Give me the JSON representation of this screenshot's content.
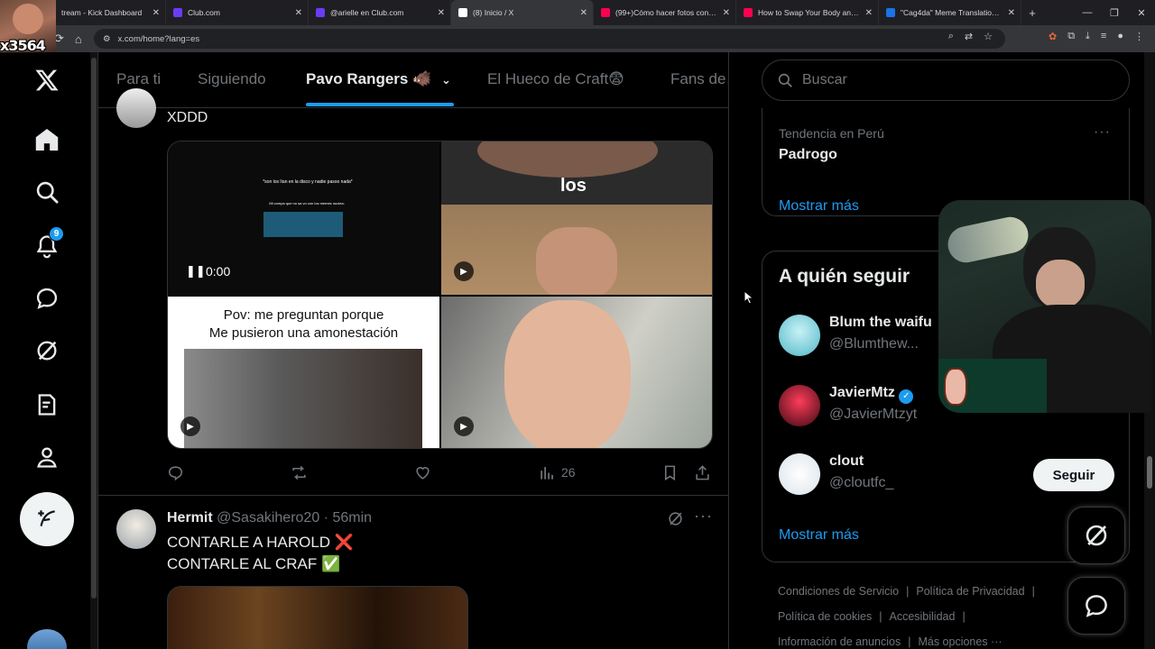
{
  "browser": {
    "tabs": [
      {
        "title": "tream - Kick Dashboard",
        "favicon_color": "#53fc18",
        "active": false
      },
      {
        "title": "Club.com",
        "favicon_color": "#6b3cf5",
        "active": false
      },
      {
        "title": "@arielle en Club.com",
        "favicon_color": "#6b3cf5",
        "active": false
      },
      {
        "title": "(8) Inicio / X",
        "favicon_color": "#ffffff",
        "active": true
      },
      {
        "title": "(99+)Cómo hacer fotos con tu",
        "favicon_color": "#ff0050",
        "active": false
      },
      {
        "title": "How to Swap Your Body and Fa",
        "favicon_color": "#ff0050",
        "active": false
      },
      {
        "title": "\"Cag4da\" Meme Translation To",
        "favicon_color": "#1a73e8",
        "active": false
      }
    ],
    "url": "x.com/home?lang=es"
  },
  "streamer_overlay": {
    "tag": "x3564"
  },
  "nav": {
    "notifications_count": "9"
  },
  "feed_tabs": {
    "items": [
      "Para ti",
      "Siguiendo",
      "Pavo Rangers 🐗",
      "El Hueco de Craft😨",
      "Fans de"
    ]
  },
  "post1": {
    "text": "XDDD",
    "media": {
      "video_time": "0:00",
      "cell1_caption": "*son los lían en la disco y nadie pasoo nada*",
      "cell1_sub": "Mi compa que no sa vo con los memes nuclea:",
      "cell2_caption": "los",
      "cell3_caption_line1": "Pov: me preguntan porque",
      "cell3_caption_line2": "Me pusieron una amonestación"
    },
    "views": "26"
  },
  "post2": {
    "name": "Hermit",
    "handle": "@Sasakihero20",
    "time": "· 56min",
    "line1": "CONTARLE A HAROLD ❌",
    "line2": "CONTARLE AL CRAF ✅"
  },
  "right": {
    "search_placeholder": "Buscar",
    "trend": {
      "context": "Tendencia en Perú",
      "name": "Padrogo"
    },
    "show_more_1": "Mostrar más",
    "who_to_follow": {
      "title": "A quién seguir",
      "accounts": [
        {
          "name": "Blum the waifu",
          "handle": "@Blumthew...",
          "verified": false
        },
        {
          "name": "JavierMtz",
          "handle": "@JavierMtzyt",
          "verified": true
        },
        {
          "name": "clout",
          "handle": "@cloutfc_",
          "verified": false,
          "button": "Seguir"
        }
      ]
    },
    "show_more_2": "Mostrar más",
    "footer": {
      "line1": [
        "Condiciones de Servicio",
        "Política de Privacidad"
      ],
      "line2": [
        "Política de cookies",
        "Accesibilidad"
      ],
      "line3": [
        "Información de anuncios",
        "Más opciones ···"
      ]
    }
  },
  "colors": {
    "accent": "#1d9bf0",
    "bg": "#000000",
    "border": "#2f3336",
    "muted": "#71767b"
  }
}
